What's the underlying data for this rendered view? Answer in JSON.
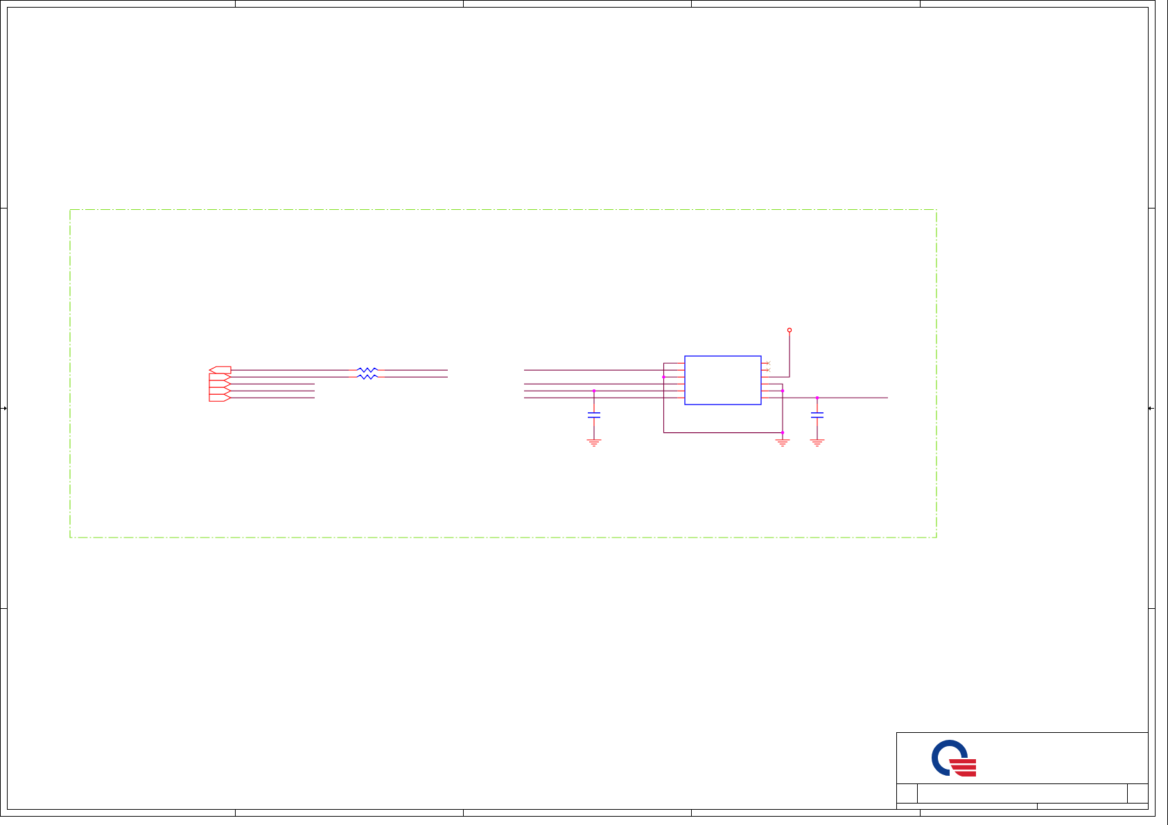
{
  "sheet": {
    "ports": [
      {
        "kind": "output",
        "series_resistor": true
      },
      {
        "kind": "input",
        "series_resistor": true
      },
      {
        "kind": "input",
        "series_resistor": false
      },
      {
        "kind": "input",
        "series_resistor": false
      },
      {
        "kind": "input",
        "series_resistor": false
      }
    ],
    "ic": {
      "left_pins": [
        {
          "no_connect": false
        },
        {
          "no_connect": false
        },
        {
          "no_connect": false
        },
        {
          "no_connect": false
        },
        {
          "no_connect": false
        },
        {
          "no_connect": false
        }
      ],
      "right_pins": [
        {
          "no_connect": true
        },
        {
          "no_connect": true
        },
        {
          "no_connect": false
        },
        {
          "no_connect": false
        },
        {
          "no_connect": false
        },
        {
          "no_connect": false
        }
      ]
    }
  }
}
